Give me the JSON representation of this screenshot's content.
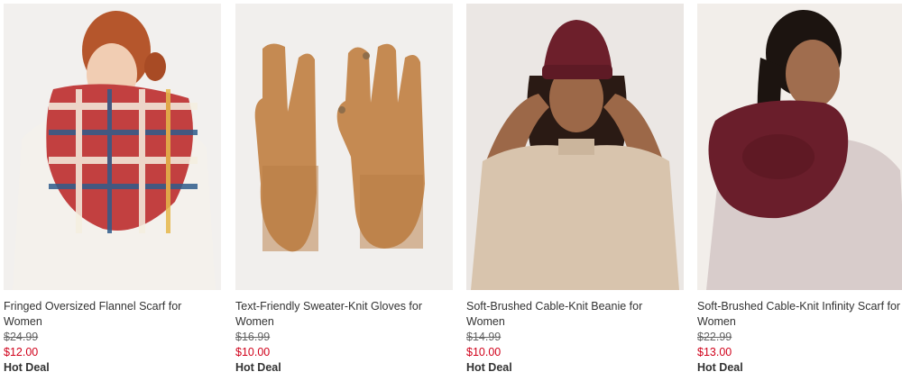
{
  "products": [
    {
      "title": "Fringed Oversized Flannel Scarf for Women",
      "original_price": "$24.99",
      "sale_price": "$12.00",
      "badge": "Hot Deal"
    },
    {
      "title": "Text-Friendly Sweater-Knit Gloves for Women",
      "original_price": "$16.99",
      "sale_price": "$10.00",
      "badge": "Hot Deal"
    },
    {
      "title": "Soft-Brushed Cable-Knit Beanie for Women",
      "original_price": "$14.99",
      "sale_price": "$10.00",
      "badge": "Hot Deal"
    },
    {
      "title": "Soft-Brushed Cable-Knit Infinity Scarf for Women",
      "original_price": "$22.99",
      "sale_price": "$13.00",
      "badge": "Hot Deal"
    }
  ],
  "colors": {
    "sale_price": "#d0021b",
    "original_price": "#666666",
    "text": "#333333"
  }
}
